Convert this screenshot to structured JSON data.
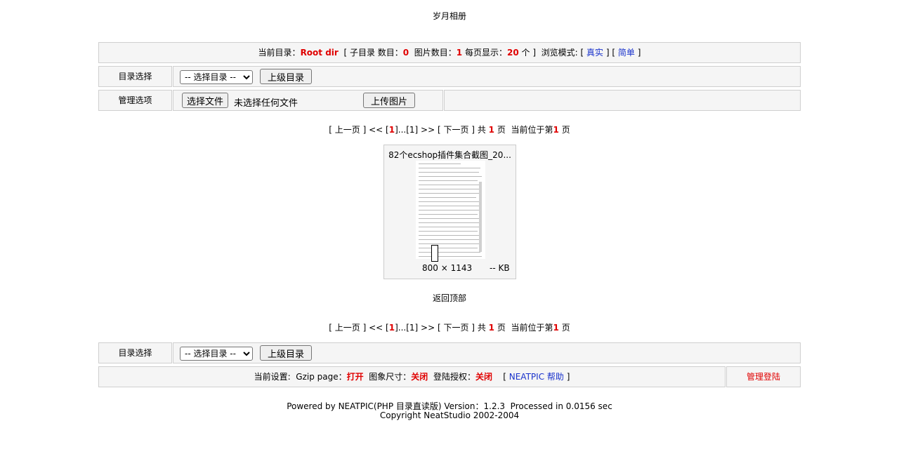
{
  "site_title": "岁月相册",
  "info_bar": {
    "current_dir_label": "当前目录：",
    "current_dir_value": "Root dir",
    "subdir_label": "[ 子目录 数目：",
    "subdir_count": "0",
    "image_count_label": "图片数目：",
    "image_count": "1",
    "per_page_label": "每页显示：",
    "per_page": "20",
    "per_page_unit": "个 ]",
    "browse_mode_label": "浏览模式: [",
    "mode_real": "真实",
    "mode_sep": "] [",
    "mode_simple": "简单",
    "mode_end": "]"
  },
  "dir_select_row": {
    "label": "目录选择",
    "select_value": "-- 选择目录 --",
    "parent_button": "上级目录"
  },
  "manage_row": {
    "label": "管理选项",
    "choose_file_button": "选择文件",
    "no_file_text": "未选择任何文件",
    "upload_button": "上传图片"
  },
  "pagination": {
    "prev": "[ 上一页 ]",
    "first": "<<",
    "lb": "[",
    "current": "1",
    "range": "]...[1]",
    "last": ">>",
    "next": "[ 下一页 ]",
    "total_label": "共",
    "total_pages": "1",
    "total_unit": "页",
    "position_label": "当前位于第",
    "position_page": "1",
    "position_unit": "页"
  },
  "thumbnail": {
    "caption": "82个ecshop插件集合截图_20...",
    "dimensions": "800 × 1143",
    "size": "-- KB"
  },
  "back_to_top": "返回顶部",
  "dir_select_row_bottom": {
    "label": "目录选择",
    "select_value": "-- 选择目录 --",
    "parent_button": "上级目录"
  },
  "settings_bar": {
    "label": "当前设置:",
    "gzip_label": "Gzip page：",
    "gzip_value": "打开",
    "image_size_label": "图象尺寸：",
    "image_size_value": "关闭",
    "login_auth_label": "登陆授权：",
    "login_auth_value": "关闭",
    "help_open": "[",
    "help_link": "NEATPIC 帮助",
    "help_close": "]",
    "admin_login": "管理登陆"
  },
  "footer": {
    "powered_by": "Powered by NEATPIC(PHP 目录直读版) Version：1.2.3  Processed in 0.0156 sec",
    "copyright": "Copyright NeatStudio 2002-2004"
  }
}
